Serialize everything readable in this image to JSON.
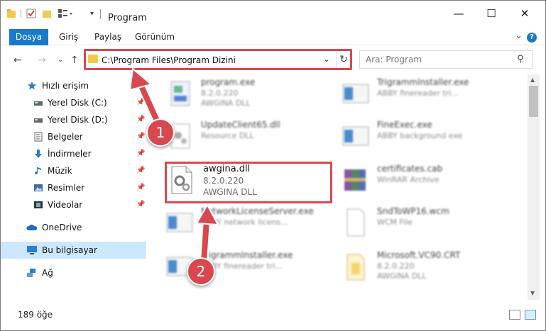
{
  "window": {
    "title": "Program",
    "minimize_glyph": "—",
    "maximize_glyph": "☐",
    "close_glyph": "✕"
  },
  "ribbon": {
    "tabs": [
      {
        "label": "Dosya"
      },
      {
        "label": "Giriş"
      },
      {
        "label": "Paylaş"
      },
      {
        "label": "Görünüm"
      }
    ],
    "help_glyph": "?"
  },
  "address": {
    "path": "C:\\Program Files\\Program Dizini",
    "search_placeholder": "Ara: Program"
  },
  "sidebar": {
    "items": [
      {
        "label": "Hızlı erişim",
        "icon": "star-icon",
        "color": "#2b7cd3"
      },
      {
        "label": "Yerel Disk (C:)",
        "icon": "drive-icon",
        "color": "#555555"
      },
      {
        "label": "Yerel Disk (D:)",
        "icon": "drive-icon",
        "color": "#555555"
      },
      {
        "label": "Belgeler",
        "icon": "document-icon",
        "color": "#6b6b6b"
      },
      {
        "label": "İndirmeler",
        "icon": "download-icon",
        "color": "#2b7cd3"
      },
      {
        "label": "Müzik",
        "icon": "music-icon",
        "color": "#2b7cd3"
      },
      {
        "label": "Resimler",
        "icon": "pictures-icon",
        "color": "#3a6fa8"
      },
      {
        "label": "Videolar",
        "icon": "video-icon",
        "color": "#333333"
      },
      {
        "label": "OneDrive",
        "icon": "cloud-icon",
        "color": "#1f6fc5"
      },
      {
        "label": "Bu bilgisayar",
        "icon": "computer-icon",
        "color": "#2b7cd3"
      },
      {
        "label": "Ağ",
        "icon": "network-icon",
        "color": "#2b7cd3"
      }
    ]
  },
  "files": [
    {
      "name": "program.exe",
      "line2": "8.2.0.220",
      "line3": "AWGINA  DLL"
    },
    {
      "name": "Trigrammlnstaller.exe",
      "line2": "ABBY finereader tri...",
      "line3": ""
    },
    {
      "name": "UpdateClient65.dll",
      "line2": "Resource DLL",
      "line3": ""
    },
    {
      "name": "FineExec.exe",
      "line2": "ABBY background exe",
      "line3": ""
    },
    {
      "name": "awgina.dll",
      "line2": "8.2.0.220",
      "line3": "AWGINA  DLL"
    },
    {
      "name": "certificates.cab",
      "line2": "WinRAR Archive",
      "line3": ""
    },
    {
      "name": "NetworkLicenseServer.exe",
      "line2": "ABBY network licens...",
      "line3": ""
    },
    {
      "name": "SndToWP16.wcm",
      "line2": "WCM File",
      "line3": ""
    },
    {
      "name": "Trigrammlnstaller.exe",
      "line2": "ABBY finereader tri...",
      "line3": ""
    },
    {
      "name": "Microsoft.VC90.CRT",
      "line2": "8.2.0.220",
      "line3": "AWGINA  DLL"
    }
  ],
  "status": {
    "count": "189 öğe"
  },
  "callouts": {
    "one": "1",
    "two": "2"
  },
  "colors": {
    "accent": "#1979ca",
    "highlight": "#d9474f",
    "selected": "#cce8ff"
  }
}
